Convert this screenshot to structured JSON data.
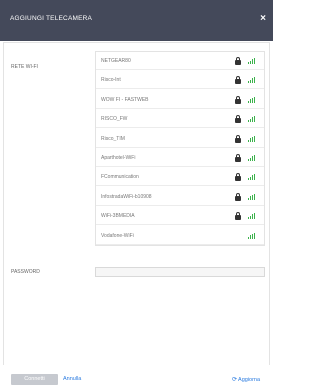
{
  "dialog": {
    "title": "AGGIUNGI TELECAMERA",
    "close_glyph": "×"
  },
  "form": {
    "wifi_label": "RETE WI-FI",
    "password_label": "PASSWORD",
    "password_value": ""
  },
  "networks": [
    {
      "ssid": "NETGEAR80",
      "secured": true
    },
    {
      "ssid": "Risco-Int",
      "secured": true
    },
    {
      "ssid": "WOW FI - FASTWEB",
      "secured": true
    },
    {
      "ssid": "RISCO_FW",
      "secured": true
    },
    {
      "ssid": "Risco_TIM",
      "secured": true
    },
    {
      "ssid": "Aparthotel-WiFi",
      "secured": true
    },
    {
      "ssid": "FCommunication",
      "secured": true
    },
    {
      "ssid": "InfostradaWiFi-b10908",
      "secured": true
    },
    {
      "ssid": "WiFi-3BMEDIA",
      "secured": true
    },
    {
      "ssid": "Vodafone-WiFi",
      "secured": false
    }
  ],
  "footer": {
    "connect_label": "Connetti",
    "cancel_label": "Annulla",
    "refresh_label": "Aggiorna",
    "refresh_glyph": "⟳"
  },
  "colors": {
    "header_bg": "#44495a",
    "signal": "#3bb24b",
    "link": "#2a7be0",
    "button_disabled": "#c6c9cf"
  },
  "icons": [
    "close-icon",
    "lock-icon",
    "wifi-signal-icon",
    "refresh-icon"
  ]
}
